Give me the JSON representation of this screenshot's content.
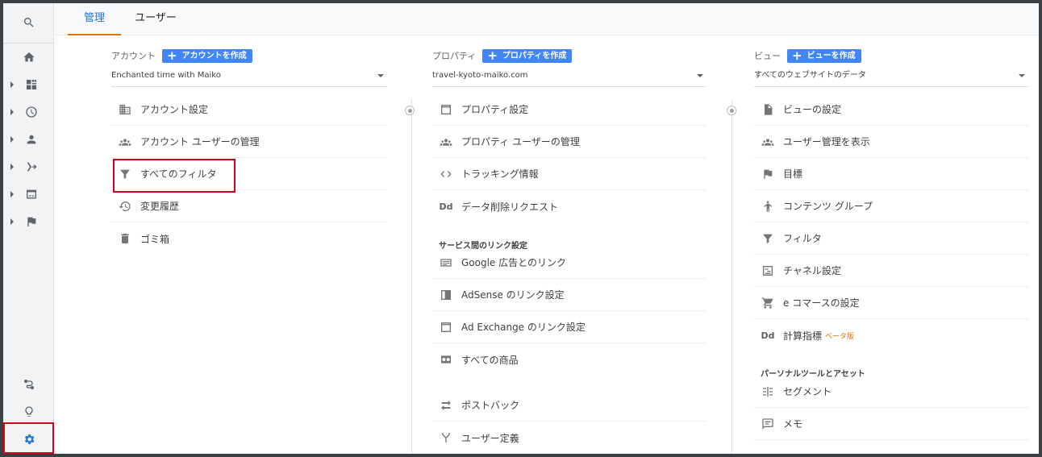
{
  "tabs": [
    {
      "label": "管理",
      "active": true
    },
    {
      "label": "ユーザー",
      "active": false
    }
  ],
  "rail": {
    "items": [
      "search-icon",
      "home-icon",
      "customization-icon",
      "realtime-icon",
      "audience-icon",
      "acquisition-icon",
      "behavior-icon",
      "conversions-icon"
    ],
    "bottom": [
      "attribution-icon",
      "discover-icon",
      "admin-gear-icon"
    ]
  },
  "account": {
    "title": "アカウント",
    "create_label": "アカウントを作成",
    "selected": "Enchanted time with Maiko",
    "items": [
      {
        "icon": "building-icon",
        "label": "アカウント設定"
      },
      {
        "icon": "people-icon",
        "label": "アカウント ユーザーの管理"
      },
      {
        "icon": "filter-icon",
        "label": "すべてのフィルタ"
      },
      {
        "icon": "history-icon",
        "label": "変更履歴"
      },
      {
        "icon": "trash-icon",
        "label": "ゴミ箱"
      }
    ]
  },
  "property": {
    "title": "プロパティ",
    "create_label": "プロパティを作成",
    "selected": "travel-kyoto-maiko.com",
    "items": [
      {
        "icon": "window-icon",
        "label": "プロパティ設定"
      },
      {
        "icon": "people-icon",
        "label": "プロパティ ユーザーの管理"
      },
      {
        "icon": "code-icon",
        "label": "トラッキング情報"
      },
      {
        "icon": "dd-icon",
        "label": "データ削除リクエスト"
      }
    ],
    "section_label": "サービス間のリンク設定",
    "link_items": [
      {
        "icon": "ads-icon",
        "label": "Google 広告とのリンク"
      },
      {
        "icon": "adsense-icon",
        "label": "AdSense のリンク設定"
      },
      {
        "icon": "ad-exchange-icon",
        "label": "Ad Exchange のリンク設定"
      },
      {
        "icon": "products-icon",
        "label": "すべての商品"
      }
    ],
    "extra_items": [
      {
        "icon": "postback-icon",
        "label": "ポストバック"
      },
      {
        "icon": "user-definition-icon",
        "label": "ユーザー定義"
      }
    ]
  },
  "view": {
    "title": "ビュー",
    "create_label": "ビューを作成",
    "selected": "すべてのウェブサイトのデータ",
    "items": [
      {
        "icon": "document-icon",
        "label": "ビューの設定"
      },
      {
        "icon": "people-icon",
        "label": "ユーザー管理を表示"
      },
      {
        "icon": "flag-icon",
        "label": "目標"
      },
      {
        "icon": "content-group-icon",
        "label": "コンテンツ グループ"
      },
      {
        "icon": "filter-icon",
        "label": "フィルタ"
      },
      {
        "icon": "channel-icon",
        "label": "チャネル設定"
      },
      {
        "icon": "cart-icon",
        "label": "e コマースの設定"
      },
      {
        "icon": "dd-icon",
        "label": "計算指標",
        "badge": "ベータ版"
      }
    ],
    "section_label": "パーソナルツールとアセット",
    "personal_items": [
      {
        "icon": "segment-icon",
        "label": "セグメント"
      },
      {
        "icon": "note-icon",
        "label": "メモ"
      }
    ]
  },
  "dd_text": "Dd",
  "colors": {
    "accent": "#1a73e8",
    "tab_underline": "#e37400",
    "button": "#4285f4",
    "highlight": "#d0021b"
  }
}
